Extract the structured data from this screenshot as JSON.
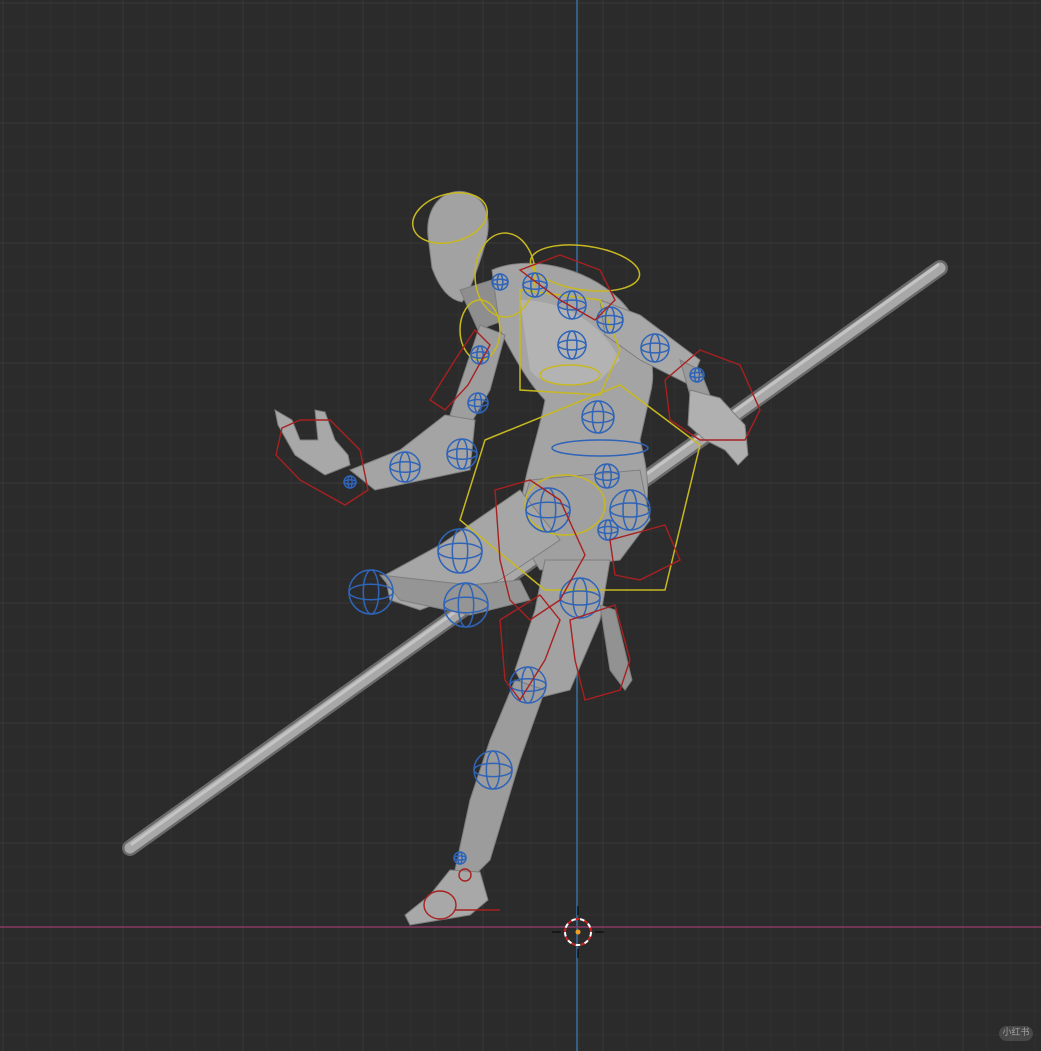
{
  "app": {
    "view": "3D viewport",
    "background_color": "#2b2b2b",
    "grid_color": "#363636",
    "axis_x_color": "#8a3a62",
    "axis_z_color": "#3a6ea0"
  },
  "scene": {
    "objects": [
      {
        "name": "mannequin-figure",
        "color": "#9c9c9c"
      },
      {
        "name": "staff-pole",
        "color": "#a4a4a4"
      },
      {
        "name": "armature-rig",
        "fk_color": "#2f64b8",
        "ik_color": "#a82020",
        "torso_color": "#c8b820"
      }
    ],
    "cursor_icon": "3d-cursor-icon"
  },
  "watermark": {
    "text": "小红书"
  }
}
